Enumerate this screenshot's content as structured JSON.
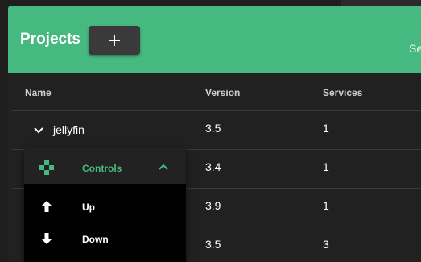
{
  "header": {
    "title": "Projects",
    "add_label": "+",
    "search_stub": "Se"
  },
  "table": {
    "columns": [
      "Name",
      "Version",
      "Services"
    ],
    "rows": [
      {
        "name": "jellyfin",
        "version": "3.5",
        "services": "1"
      },
      {
        "name": "",
        "version": "3.4",
        "services": "1"
      },
      {
        "name": "",
        "version": "3.9",
        "services": "1"
      },
      {
        "name": "",
        "version": "3.5",
        "services": "3"
      }
    ]
  },
  "menu": {
    "title": "Controls",
    "items": [
      {
        "label": "Up",
        "icon": "arrow-up-icon"
      },
      {
        "label": "Down",
        "icon": "arrow-down-icon"
      }
    ]
  },
  "colors": {
    "accent": "#46b980",
    "background": "#1e1e1e",
    "menu_background": "#000000"
  }
}
